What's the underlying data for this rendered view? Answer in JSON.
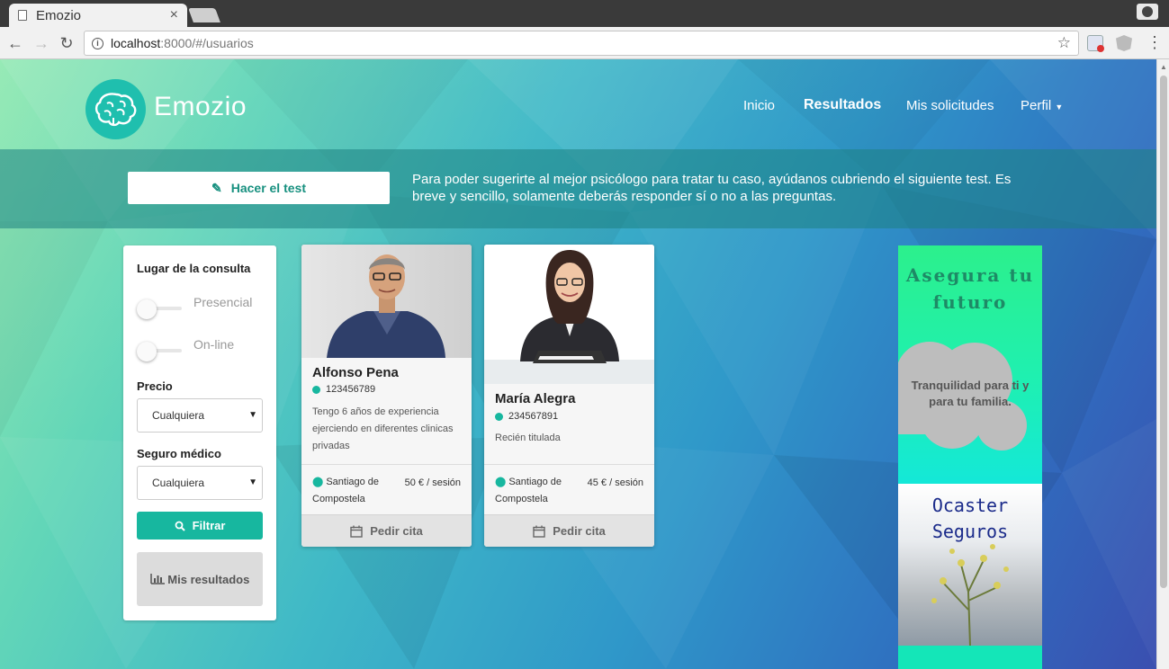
{
  "browser": {
    "tab_title": "Emozio",
    "url_host": "localhost",
    "url_rest": ":8000/#/usuarios"
  },
  "site": {
    "brand": "Emozio",
    "nav": [
      {
        "label": "Inicio",
        "active": false
      },
      {
        "label": "Resultados",
        "active": true
      },
      {
        "label": "Mis solicitudes",
        "active": false
      },
      {
        "label": "Perfil",
        "active": false
      }
    ]
  },
  "banner": {
    "button_label": "Hacer el test",
    "text": "Para poder sugerirte al mejor psicólogo para tratar tu caso, ayúdanos cubriendo el siguiente test. Es breve y sencillo, solamente deberás responder sí o no a las preguntas."
  },
  "filters": {
    "location_label": "Lugar de la consulta",
    "options": [
      {
        "label": "Presencial",
        "checked": false
      },
      {
        "label": "On-line",
        "checked": false
      }
    ],
    "price_label": "Precio",
    "price_value": "Cualquiera",
    "insurance_label": "Seguro médico",
    "insurance_value": "Cualquiera",
    "filter_button": "Filtrar",
    "results_button": "Mis resultados"
  },
  "psychologists": [
    {
      "name": "Alfonso Pena",
      "code": "123456789",
      "description": "Tengo 6 años de experiencia ejerciendo en diferentes clinicas privadas",
      "location": "Santiago de Compostela",
      "price": "50 € / sesión",
      "button": "Pedir cita"
    },
    {
      "name": "María Alegra",
      "code": "234567891",
      "description": "Recién titulada",
      "location": "Santiago de Compostela",
      "price": "45 € / sesión",
      "button": "Pedir cita"
    }
  ],
  "ad": {
    "title": "Asegura tu futuro",
    "tagline": "Tranquilidad para ti y para tu familia.",
    "brand": "Ocaster Seguros"
  },
  "colors": {
    "accent": "#17b79f",
    "accent_text": "#17907f"
  }
}
